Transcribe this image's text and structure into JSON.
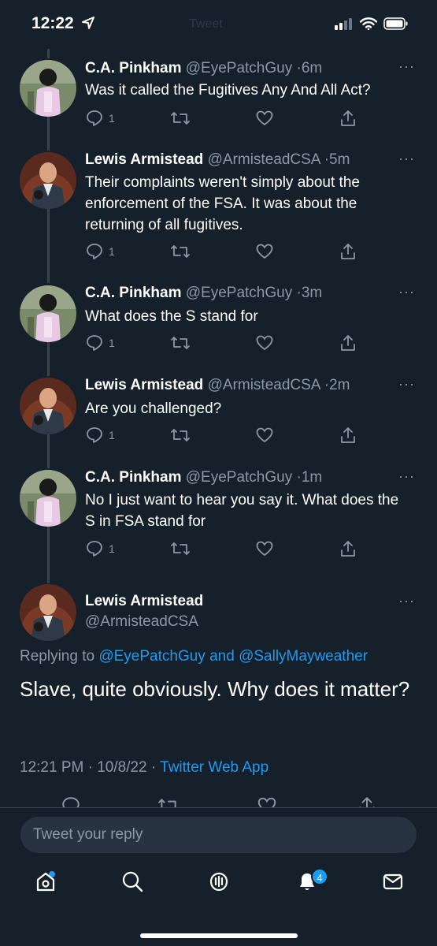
{
  "status_bar": {
    "time": "12:22",
    "header_ghost": "Tweet"
  },
  "tweets": [
    {
      "name": "C.A. Pinkham",
      "handle": "@EyePatchGuy",
      "time": "6m",
      "text": "Was it called the Fugitives Any And All Act?",
      "replies": "1"
    },
    {
      "name": "Lewis Armistead",
      "handle": "@ArmisteadCSA",
      "time": "5m",
      "text": "Their complaints weren't simply about the enforcement of the FSA. It was about the returning of all fugitives.",
      "replies": "1"
    },
    {
      "name": "C.A. Pinkham",
      "handle": "@EyePatchGuy",
      "time": "3m",
      "text": "What does the S stand for",
      "replies": "1"
    },
    {
      "name": "Lewis Armistead",
      "handle": "@ArmisteadCSA",
      "time": "2m",
      "text": "Are you challenged?",
      "replies": "1"
    },
    {
      "name": "C.A. Pinkham",
      "handle": "@EyePatchGuy",
      "time": "1m",
      "text": "No I just want to hear you say it. What does the S in FSA stand for",
      "replies": "1"
    }
  ],
  "main_tweet": {
    "name": "Lewis Armistead",
    "handle": "@ArmisteadCSA",
    "replying_prefix": "Replying to",
    "replying_to_1": "@EyePatchGuy",
    "replying_and": "and",
    "replying_to_2": "@SallyMayweather",
    "text": "Slave, quite obviously. Why does it matter?",
    "timestamp": "12:21 PM · 10/8/22 ·",
    "source": "Twitter Web App"
  },
  "reply_box": {
    "placeholder": "Tweet your reply"
  },
  "tabbar": {
    "notification_count": "4"
  },
  "more_label": "···",
  "colors": {
    "background": "#15202b",
    "accent": "#1d9bf0",
    "muted": "#8b98a5"
  }
}
